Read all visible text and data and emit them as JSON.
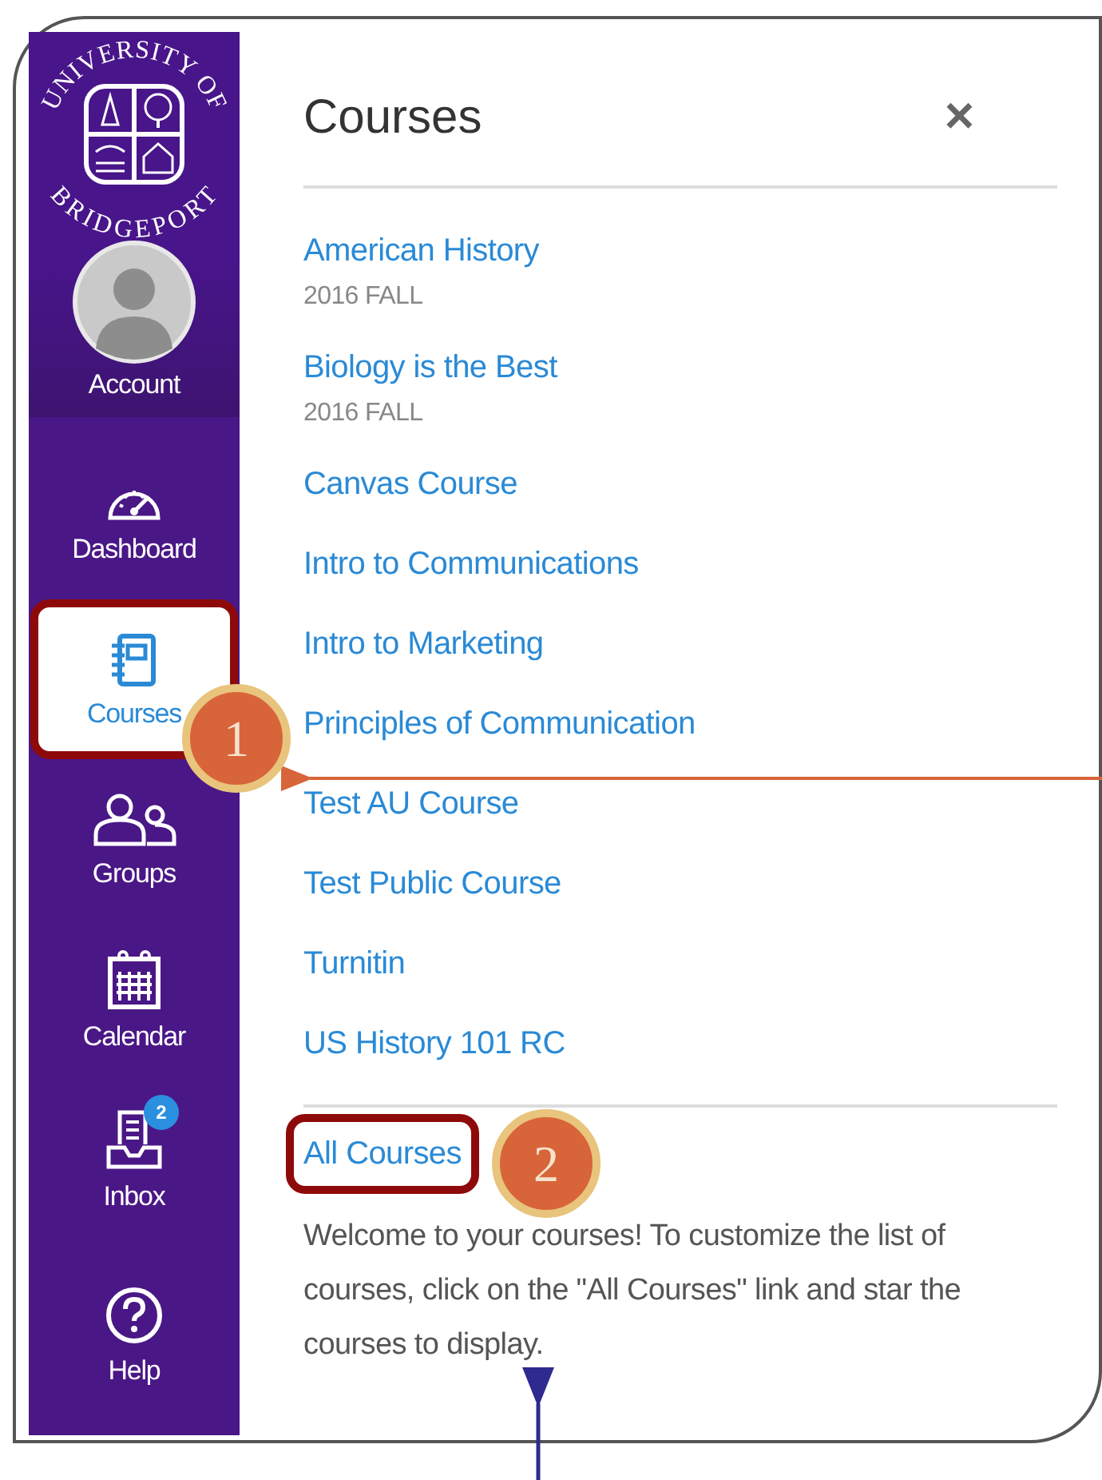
{
  "logo": {
    "top_text": "UNIVERSITY OF",
    "bottom_text": "BRIDGEPORT"
  },
  "nav": [
    {
      "label": "Account",
      "kind": "account",
      "selected": false
    },
    {
      "label": "Dashboard",
      "kind": "dashboard",
      "selected": false
    },
    {
      "label": "Courses",
      "kind": "courses",
      "selected": true,
      "callout": "1"
    },
    {
      "label": "Groups",
      "kind": "groups",
      "selected": false
    },
    {
      "label": "Calendar",
      "kind": "calendar",
      "selected": false
    },
    {
      "label": "Inbox",
      "kind": "inbox",
      "selected": false,
      "badge": "2"
    },
    {
      "label": "Help",
      "kind": "help",
      "selected": false
    }
  ],
  "panel": {
    "title": "Courses",
    "close": "×",
    "courses": [
      {
        "name": "American History",
        "term": "2016 FALL"
      },
      {
        "name": "Biology is the Best",
        "term": "2016 FALL"
      },
      {
        "name": "Canvas Course"
      },
      {
        "name": "Intro to Communications"
      },
      {
        "name": "Intro to Marketing"
      },
      {
        "name": "Principles of Communication"
      },
      {
        "name": "Test AU Course"
      },
      {
        "name": "Test Public Course"
      },
      {
        "name": "Turnitin"
      },
      {
        "name": "US History 101 RC"
      }
    ],
    "all_courses": {
      "label": "All Courses",
      "callout": "2"
    },
    "welcome": "Welcome to your courses! To customize the list of courses, click on the \"All Courses\" link and star the courses to display."
  }
}
